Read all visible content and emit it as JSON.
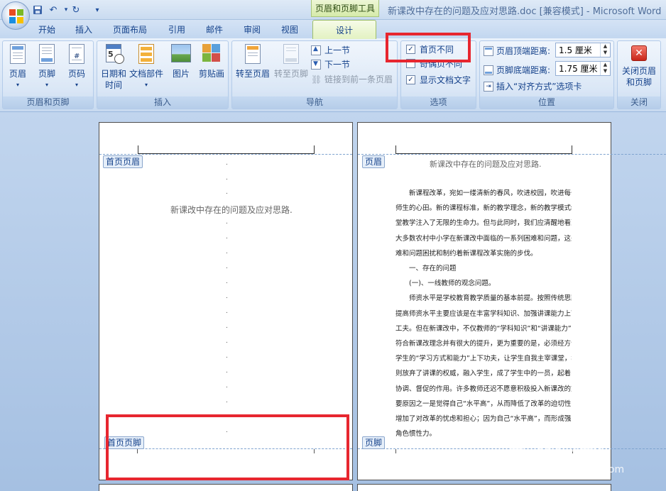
{
  "window": {
    "title": "新课改中存在的问题及应对思路.doc [兼容模式] - Microsoft Word",
    "context_tab_header": "页眉和页脚工具"
  },
  "qat": {
    "save_icon": "save-icon",
    "undo_icon": "undo-icon",
    "redo_icon": "redo-icon"
  },
  "tabs": [
    "开始",
    "插入",
    "页面布局",
    "引用",
    "邮件",
    "审阅",
    "视图",
    "设计"
  ],
  "active_tab": "设计",
  "groups": {
    "header_footer": {
      "label": "页眉和页脚",
      "header": "页眉",
      "footer": "页脚",
      "page_number": "页码"
    },
    "insert": {
      "label": "插入",
      "datetime_1": "日期和",
      "datetime_2": "时间",
      "doc_parts": "文档部件",
      "picture": "图片",
      "clipart": "剪贴画"
    },
    "navigation": {
      "label": "导航",
      "goto_header": "转至页眉",
      "goto_footer": "转至页脚",
      "prev": "上一节",
      "next": "下一节",
      "link_prev": "链接到前一条页眉"
    },
    "options": {
      "label": "选项",
      "diff_first": "首页不同",
      "diff_odd_even": "奇偶页不同",
      "show_text": "显示文档文字",
      "diff_first_checked": true,
      "diff_odd_even_checked": false,
      "show_text_checked": true
    },
    "position": {
      "label": "位置",
      "header_top": "页眉顶端距离:",
      "header_top_value": "1.5 厘米",
      "footer_bottom": "页脚底端距离:",
      "footer_bottom_value": "1.75 厘米",
      "insert_align": "插入“对齐方式”选项卡"
    },
    "close": {
      "label": "关闭",
      "close_1": "关闭页眉",
      "close_2": "和页脚"
    }
  },
  "page1": {
    "header_tag": "首页页眉",
    "footer_tag": "首页页脚",
    "title": "新课改中存在的问题及应对思路.",
    "mark": ".",
    "enter": "↵"
  },
  "page2": {
    "header_tag": "页眉",
    "footer_tag": "页脚",
    "title": "新课改中存在的问题及应对思路.",
    "lines": [
      "新课程改革，宛如一缕清新的春风，吹进校园，吹进每一位",
      "师生的心田。新的课程标准，新的教学理念，新的教学模式给课",
      "堂教学注入了无限的生命力。但与此同时，我们应清醒地看到绝",
      "大多数农村中小学在新课改中面临的一系列困难和问题，这些困",
      "难和问题困扰和制约着新课程改革实施的步伐。",
      "一、存在的问题",
      "(一)、一线教师的观念问题。",
      "师资水平是学校教育教学质量的基本前提。按照传统思路，",
      "提高师资水平主要应该是在丰富学科知识、加强讲课能力上下",
      "工夫。但在新课改中，不仅教师的“学科知识”和“讲课能力”要",
      "符合新课改理念并有很大的提升，更为重要的是，必须经方设法在",
      "学生的“学习方式和能力”上下功夫，让学生自我主宰课堂，教师",
      "则放弃了讲课的权威，融入学生，成了学生中的一员，起着引导、",
      "协调、督促的作用。许多教师还迟不愿意积极投入新课改的重",
      "要原因之一是觉得自己“水平高”，从而降低了改革的迫切性，",
      "增加了对改革的忧虑和担心；因为自己“水平高”，而形成强大的",
      "角色惯性力。"
    ]
  },
  "watermark": {
    "brand": "Bai经验",
    "url": "jingyan.baidu.com"
  }
}
